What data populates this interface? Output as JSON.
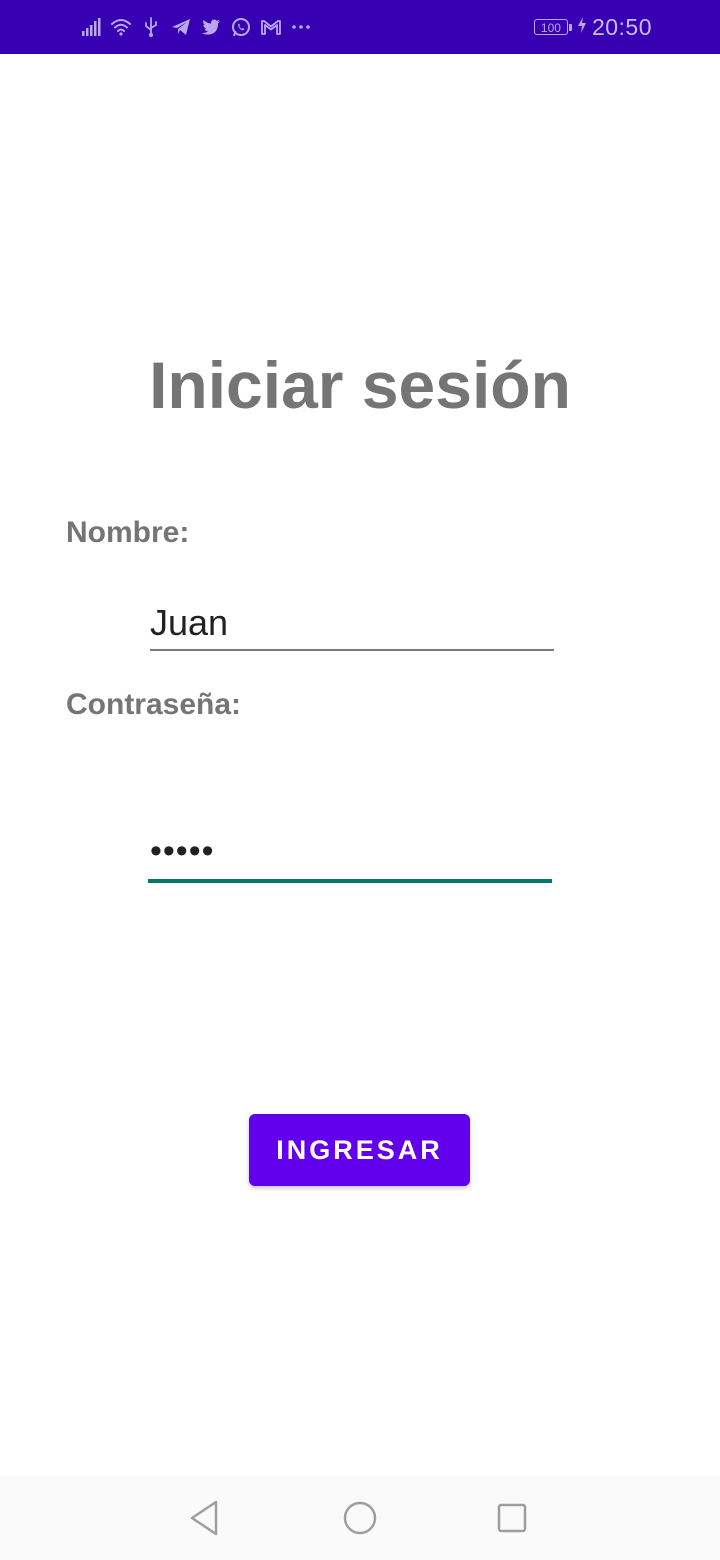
{
  "status_bar": {
    "time": "20:50",
    "battery_level": "100",
    "icons": [
      "signal-icon",
      "wifi-icon",
      "usb-icon",
      "telegram-icon",
      "twitter-icon",
      "whatsapp-icon",
      "gmail-icon",
      "more-icon",
      "battery-icon",
      "charging-icon"
    ],
    "background_color": "#3700b3"
  },
  "login": {
    "title": "Iniciar sesión",
    "name_label": "Nombre:",
    "name_value": "Juan",
    "password_label": "Contraseña:",
    "password_value": "•••••",
    "submit_label": "INGRESAR"
  },
  "colors": {
    "accent": "#6200ee",
    "field_focus": "#00796b",
    "label_text": "#757575"
  },
  "nav_bar": {
    "icons": [
      "back-icon",
      "home-icon",
      "recents-icon"
    ]
  }
}
